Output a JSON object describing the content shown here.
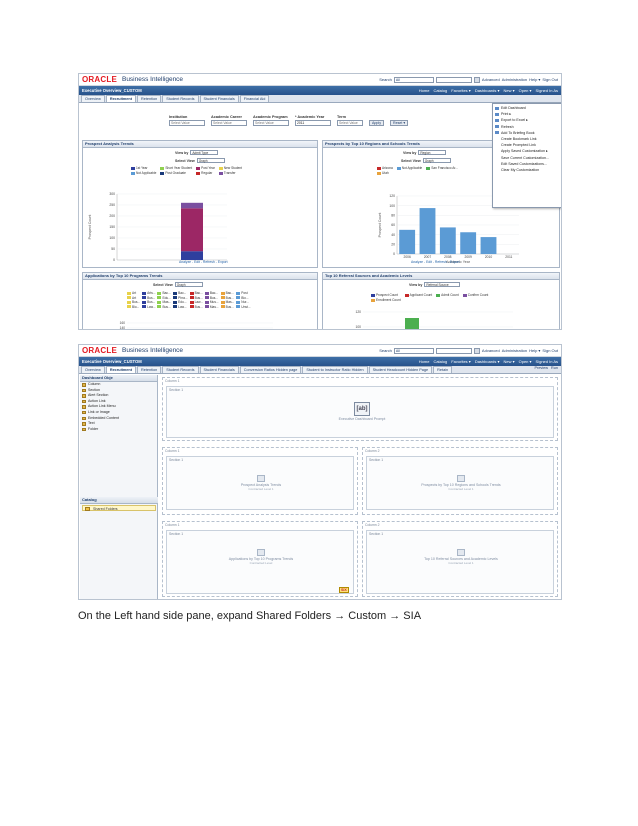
{
  "header": {
    "logo": "ORACLE",
    "product": "Business Intelligence",
    "search_label": "Search",
    "search_scope": "All",
    "links": [
      "Advanced",
      "Administration",
      "Help ▾",
      "Sign Out"
    ],
    "signed_in": "Signed In As"
  },
  "shot1": {
    "dashboard_name": "Executive Overview_CUSTOM",
    "menu": [
      "Home",
      "Catalog",
      "Favorites ▾",
      "Dashboards ▾",
      "New ▾",
      "Open ▾",
      "Signed In As"
    ],
    "tabs": [
      "Overview",
      "Recruitment",
      "Retention",
      "Student Records",
      "Student Financials",
      "Financial Aid"
    ],
    "prompts": [
      {
        "label": "Institution",
        "value": "Select Value"
      },
      {
        "label": "Academic Career",
        "value": "Select Value"
      },
      {
        "label": "Academic Program",
        "value": "Select Value"
      },
      {
        "label": "* Academic Year",
        "value": "2011"
      },
      {
        "label": "Term",
        "value": "Select Value"
      }
    ],
    "apply_label": "Apply",
    "reset_label": "Reset ▾",
    "panel1": {
      "title": "Prospect Analysis Trends",
      "view_by_label": "View by",
      "view_by_value": "Admit Type",
      "select_view_label": "Select View",
      "select_view_value": "Graph",
      "legend": [
        "1st Year",
        "Not Applicable",
        "Short Year Student",
        "Post Graduate",
        "Post Year",
        "Regular",
        "New Student",
        "Transfer"
      ],
      "ylabel": "Prospect Count",
      "links": "Analyze - Edit - Refresh - Export"
    },
    "panel2": {
      "title": "Prospects by Top 10 Regions and Schools Trends",
      "view_by_label": "View by",
      "view_by_value": "Region",
      "select_view_label": "Select View",
      "select_view_value": "Graph",
      "legend": [
        "Arizona",
        "Not Applicable",
        "San Francisco Ar...",
        "Utah"
      ],
      "ylabel": "Prospect Count",
      "xlabel": "Academic Year",
      "links": "Analyze - Edit - Refresh - Export"
    },
    "panel3": {
      "title": "Applications by Top 10 Programs Trends",
      "select_view_label": "Select View",
      "select_view_value": "Graph",
      "legend": [
        "Art",
        "Arts...",
        "Bac...",
        "Bac...",
        "Bac...",
        "Bac...",
        "Bac...",
        "Post",
        "Art",
        "Bus...",
        "Edu...",
        "Phra...",
        "Bus...",
        "Bus...",
        "Bus...",
        "Bio...",
        "Bus...",
        "Bus...",
        "Mas...",
        "Edu...",
        "Law...",
        "Mus...",
        "Mas...",
        "Nur...",
        "Bio...",
        "Law...",
        "Bus...",
        "Law...",
        "Bus...",
        "Mas...",
        "Bus...",
        "Unst..."
      ],
      "y_ticks": [
        "160",
        "140",
        "120"
      ]
    },
    "panel4": {
      "title": "Top 10 Referral Sources and Academic Levels",
      "view_by_label": "View by",
      "view_by_value": "Referral Source",
      "legend": [
        "Prospect Count",
        "Applicant Count",
        "Admit Count",
        "Confirm Count",
        "Enrollment Count"
      ],
      "y_ticks": [
        "120",
        "100",
        "80"
      ]
    },
    "page_options": [
      "Edit Dashboard",
      "Print",
      "Export to Excel",
      "Refresh",
      "Add To Briefing Book",
      "Create Bookmark Link",
      "Create Prompted Link",
      "Apply Saved Customization",
      "Save Current Customization...",
      "Edit Saved Customizations...",
      "Clear My Customization"
    ]
  },
  "chart_left": {
    "y_ticks": [
      "300",
      "250",
      "200",
      "150",
      "100",
      "50",
      "0"
    ],
    "x_ticks": []
  },
  "chart_right": {
    "y_ticks": [
      "120",
      "100",
      "80",
      "60",
      "40",
      "20",
      "0"
    ],
    "x_ticks": [
      "2006",
      "2007",
      "2008",
      "2009",
      "2010",
      "2011"
    ]
  },
  "chart_data": [
    {
      "type": "bar",
      "stacked": true,
      "title": "Prospect Analysis Trends",
      "ylabel": "Prospect Count",
      "ylim": [
        0,
        300
      ],
      "categories": [
        ""
      ],
      "series": [
        {
          "name": "Post Graduate",
          "values": [
            40
          ]
        },
        {
          "name": "Regular",
          "values": [
            195
          ]
        },
        {
          "name": "Transfer",
          "values": [
            25
          ]
        }
      ]
    },
    {
      "type": "bar",
      "title": "Prospects by Top 10 Regions and Schools Trends",
      "ylabel": "Prospect Count",
      "xlabel": "Academic Year",
      "ylim": [
        0,
        120
      ],
      "categories": [
        "2006",
        "2007",
        "2008",
        "2009",
        "2010",
        "2011"
      ],
      "values": [
        50,
        95,
        55,
        45,
        35,
        0
      ]
    },
    {
      "type": "bar",
      "title": "Top 10 Referral Sources and Academic Levels",
      "ylim": [
        80,
        120
      ],
      "categories": [
        "",
        ""
      ],
      "series": [
        {
          "name": "Prospect Count",
          "values": [
            0,
            0
          ]
        },
        {
          "name": "Admit Count",
          "values": [
            112,
            0
          ]
        },
        {
          "name": "Applicant Count",
          "values": [
            0,
            82
          ]
        }
      ]
    }
  ],
  "shot2": {
    "dashboard_name": "Executive Overview_CUSTOM",
    "menu": [
      "Home",
      "Catalog",
      "Favorites ▾",
      "Dashboards ▾",
      "New ▾",
      "Open ▾",
      "Signed In As"
    ],
    "tabs": [
      "Overview",
      "Recruitment",
      "Retention",
      "Student Records",
      "Student Financials",
      "Conversion Ratios Hidden page",
      "Student to Instructor Ratio Hidden",
      "Student Headcount Hidden Page",
      "Retain"
    ],
    "toolbar": [
      "Preview",
      "Run"
    ],
    "objects_head": "Dashboard Obje",
    "objects": [
      "Column",
      "Section",
      "Alert Section",
      "Action Link",
      "Action Link Menu",
      "Link or Image",
      "Embedded Content",
      "Text",
      "Folder"
    ],
    "catalog_head": "Catalog",
    "shared_folders": "Shared Folders",
    "columns": [
      "Column 1",
      "Column 1",
      "Column 2",
      "Column 1",
      "Column 2"
    ],
    "sections": [
      "Section 1",
      "Section 1",
      "Section 1",
      "Section 1",
      "Section 1"
    ],
    "prompt_placeholder": "Executive Dashboard Prompt",
    "ab_label": "[ab]",
    "placeholders": [
      {
        "title": "Prospect Analysis Trends",
        "sub": "Contracted Level 1"
      },
      {
        "title": "Prospects by Top 10 Regions and Schools Trends",
        "sub": "Contracted Level 1"
      },
      {
        "title": "Applications by Top 10 Programs Trends",
        "sub": "Contracted Level"
      },
      {
        "title": "Top 10 Referral Sources and Academic Levels",
        "sub": "Contracted Level 1"
      }
    ],
    "badge": "SIX"
  },
  "caption": "On the Left hand side pane, expand Shared Folders → Custom → SIA",
  "colors": {
    "brand_red": "#e31b23",
    "bar_blue": "#5b9bd5",
    "magenta": "#9c2765",
    "navy": "#2f3f9e",
    "green": "#4caf50",
    "red": "#d32f2f"
  }
}
